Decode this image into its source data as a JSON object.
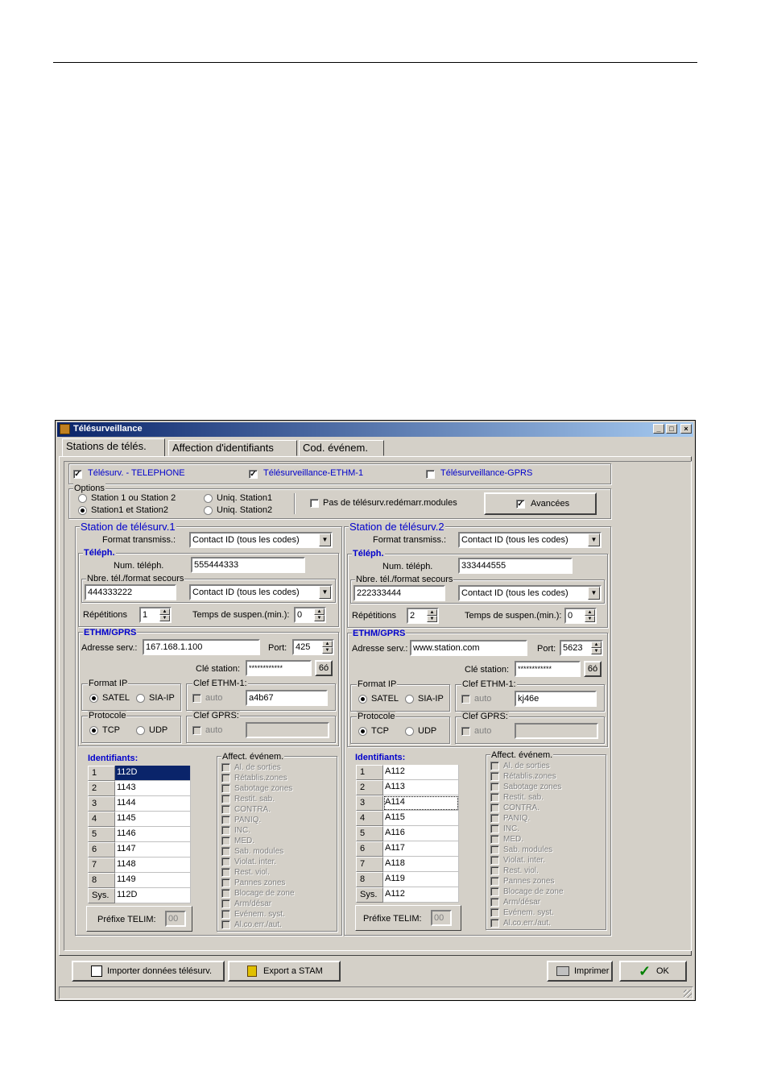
{
  "window": {
    "title": "Télésurveillance",
    "min_label": "_",
    "max_label": "□",
    "close_label": "×"
  },
  "tabs": [
    "Stations de télés.",
    "Affection d'identifiants",
    "Cod. événem."
  ],
  "top_checks": [
    {
      "label": "Télésurv. - TELEPHONE",
      "checked": true
    },
    {
      "label": "Télésurveillance-ETHM-1",
      "checked": true
    },
    {
      "label": "Télésurveillance-GPRS",
      "checked": false
    }
  ],
  "options": {
    "group_label": "Options",
    "radio1": "Station 1 ou Station 2",
    "radio2": "Station1 et Station2",
    "radio3": "Uniq. Station1",
    "radio4": "Uniq. Station2",
    "no_restart": "Pas de télésurv.redémarr.modules",
    "advanced": "Avancées"
  },
  "labels": {
    "format": "Format transmiss.:",
    "teleph": "Téléph.",
    "num": "Num. téléph.",
    "backup": "Nbre. tél./format secours",
    "repetitions": "Répétitions",
    "suspend": "Temps de suspen.(min.):",
    "ethm": "ETHM/GPRS",
    "addr": "Adresse serv.:",
    "port": "Port:",
    "key": "Clé station:",
    "key_btn": "6ó",
    "format_ip": "Format IP",
    "satel": "SATEL",
    "siaip": "SIA-IP",
    "clef_ethm": "Clef ETHM-1:",
    "auto": "auto",
    "protocole": "Protocole",
    "tcp": "TCP",
    "udp": "UDP",
    "clef_gprs": "Clef GPRS:",
    "identifiants": "Identifiants:",
    "affect": "Affect. événem.",
    "prefix": "Préfixe TELIM:",
    "sys": "Sys."
  },
  "affect_items": [
    "Al. de sorties",
    "Rétablis.zones",
    "Sabotage zones",
    "Restit. sab.",
    "CONTRA.",
    "PANIQ.",
    "INC.",
    "MED.",
    "Sab. modules",
    "Violat. inter.",
    "Rest. viol.",
    "Pannes zones",
    "Blocage de zone",
    "Arm/désar",
    "Evénem. syst.",
    "Al.co.err./aut."
  ],
  "station1": {
    "title": "Station de télésurv.1",
    "format": "Contact ID (tous les codes)",
    "phone": "555444333",
    "backup_phone": "444333222",
    "backup_format": "Contact ID (tous les codes)",
    "repetitions": "1",
    "suspend": "0",
    "address": "167.168.1.100",
    "port": "425",
    "key": "************",
    "ethm_key": "a4b67",
    "gprs_key": "",
    "prefix": "00",
    "ids": [
      "112D",
      "1143",
      "1144",
      "1145",
      "1146",
      "1147",
      "1148",
      "1149"
    ],
    "sys": "112D"
  },
  "station2": {
    "title": "Station de télésurv.2",
    "format": "Contact ID (tous les codes)",
    "phone": "333444555",
    "backup_phone": "222333444",
    "backup_format": "Contact ID (tous les codes)",
    "repetitions": "2",
    "suspend": "0",
    "address": "www.station.com",
    "port": "5623",
    "key": "************",
    "ethm_key": "kj46e",
    "gprs_key": "",
    "prefix": "00",
    "ids": [
      "A112",
      "A113",
      "A114",
      "A115",
      "A116",
      "A117",
      "A118",
      "A119"
    ],
    "sys": "A112"
  },
  "footer": {
    "import": "Importer données télésurv.",
    "export": "Export a STAM",
    "print": "Imprimer",
    "ok": "OK"
  }
}
